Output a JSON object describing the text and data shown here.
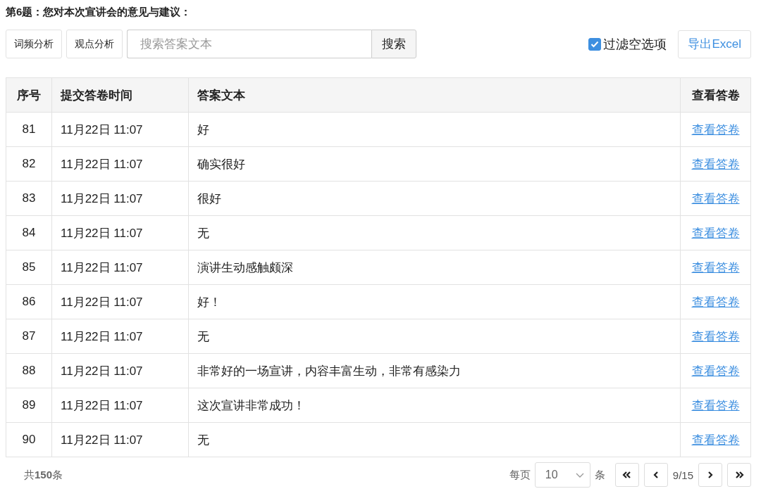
{
  "question_title": "第6题：您对本次宣讲会的意见与建议：",
  "toolbar": {
    "buttons": [
      {
        "label": "词频分析"
      },
      {
        "label": "观点分析"
      }
    ],
    "search": {
      "placeholder": "搜索答案文本",
      "button": "搜索"
    },
    "filter": {
      "label": "过滤空选项",
      "checked": true
    },
    "export_button": "导出Excel"
  },
  "table": {
    "columns": [
      "序号",
      "提交答卷时间",
      "答案文本",
      "查看答卷"
    ],
    "rows": [
      {
        "index": "81",
        "time": "11月22日 11:07",
        "answer": "好",
        "link": "查看答卷"
      },
      {
        "index": "82",
        "time": "11月22日 11:07",
        "answer": "确实很好",
        "link": "查看答卷"
      },
      {
        "index": "83",
        "time": "11月22日 11:07",
        "answer": "很好",
        "link": "查看答卷"
      },
      {
        "index": "84",
        "time": "11月22日 11:07",
        "answer": "无",
        "link": "查看答卷"
      },
      {
        "index": "85",
        "time": "11月22日 11:07",
        "answer": "演讲生动感触颇深",
        "link": "查看答卷"
      },
      {
        "index": "86",
        "time": "11月22日 11:07",
        "answer": "好！",
        "link": "查看答卷"
      },
      {
        "index": "87",
        "time": "11月22日 11:07",
        "answer": "无",
        "link": "查看答卷"
      },
      {
        "index": "88",
        "time": "11月22日 11:07",
        "answer": "非常好的一场宣讲，内容丰富生动，非常有感染力",
        "link": "查看答卷"
      },
      {
        "index": "89",
        "time": "11月22日 11:07",
        "answer": "这次宣讲非常成功！",
        "link": "查看答卷"
      },
      {
        "index": "90",
        "time": "11月22日 11:07",
        "answer": "无",
        "link": "查看答卷"
      }
    ]
  },
  "footer": {
    "total": "共**150**条",
    "per_page_label": "每页",
    "per_page_value": "10",
    "per_page_unit": "条",
    "page": "9/15"
  }
}
